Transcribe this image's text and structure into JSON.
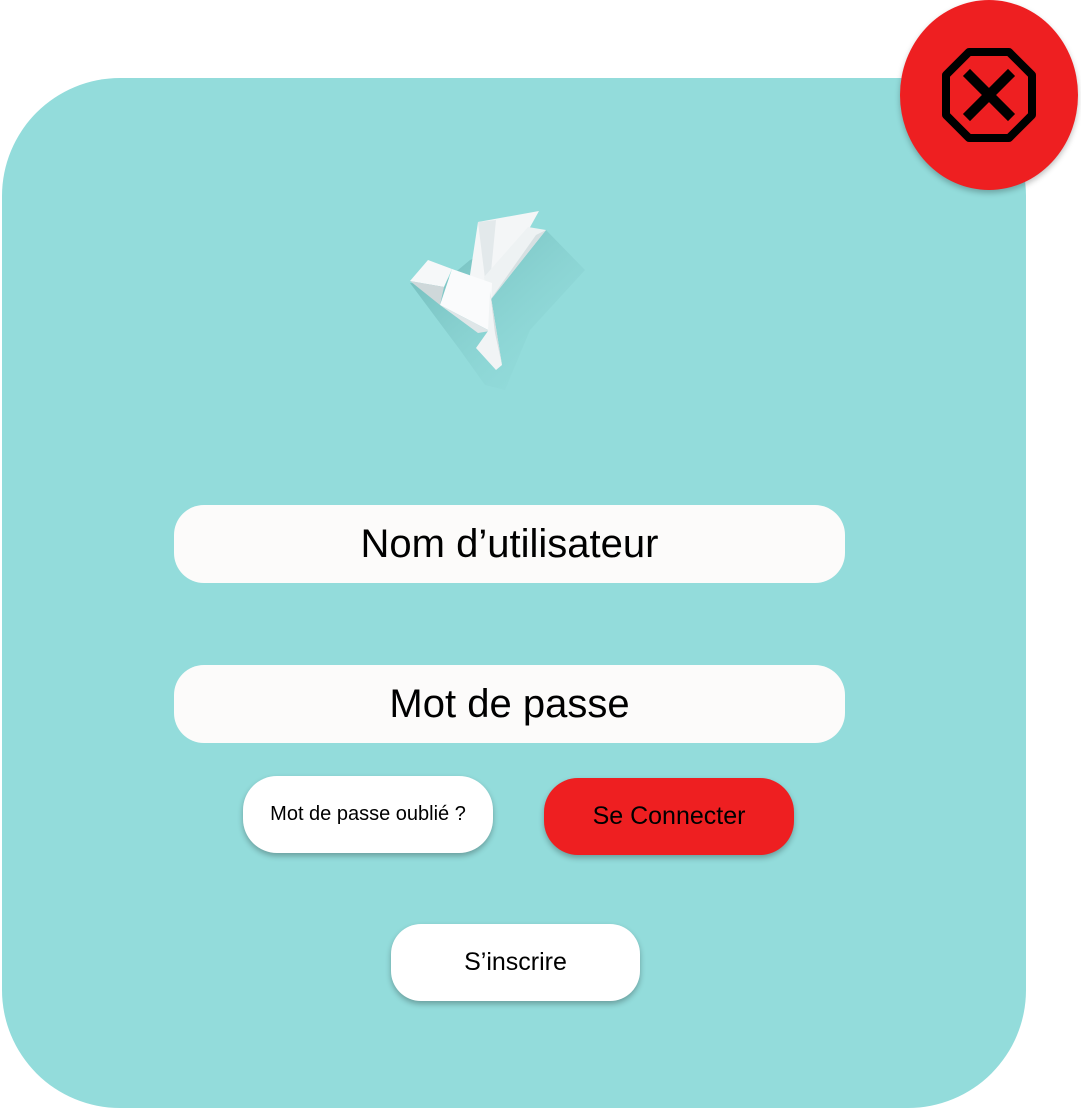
{
  "login": {
    "username_placeholder": "Nom d’utilisateur",
    "password_placeholder": "Mot de passe",
    "forgot_password_label": "Mot de passe oublié ?",
    "login_label": "Se Connecter",
    "signup_label": "S’inscrire"
  },
  "icons": {
    "logo": "origami-bird-icon",
    "close": "close-circle-icon"
  },
  "colors": {
    "card_background": "#93dcdb",
    "field_background": "#fcfbfa",
    "accent_red": "#ee1f21",
    "text": "#000000"
  }
}
